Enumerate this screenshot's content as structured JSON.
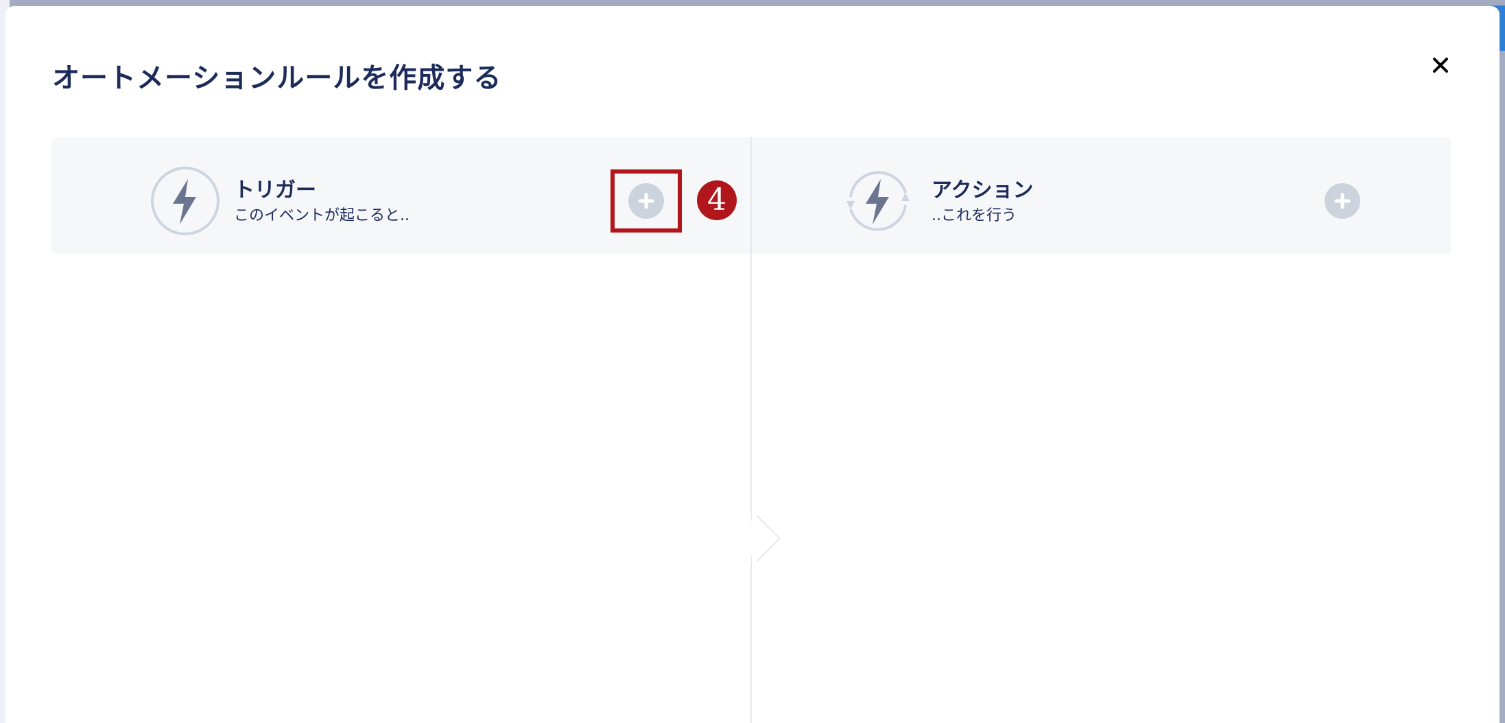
{
  "modal": {
    "title": "オートメーションルールを作成する",
    "close_label": "×"
  },
  "trigger": {
    "title": "トリガー",
    "subtitle": "このイベントが起こると..",
    "icon": "lightning-bolt-icon",
    "add_icon": "plus-icon"
  },
  "action": {
    "title": "アクション",
    "subtitle": "..これを行う",
    "icon": "lightning-cycle-icon",
    "add_icon": "plus-icon"
  },
  "annotation": {
    "step_number": "4",
    "color": "#b0161b"
  },
  "colors": {
    "title": "#1c2b5a",
    "icon_gray": "#6b7590",
    "ring": "#cdd5e0",
    "add_button": "#cdd3dd",
    "panel_bg": "#f6f7f9"
  }
}
